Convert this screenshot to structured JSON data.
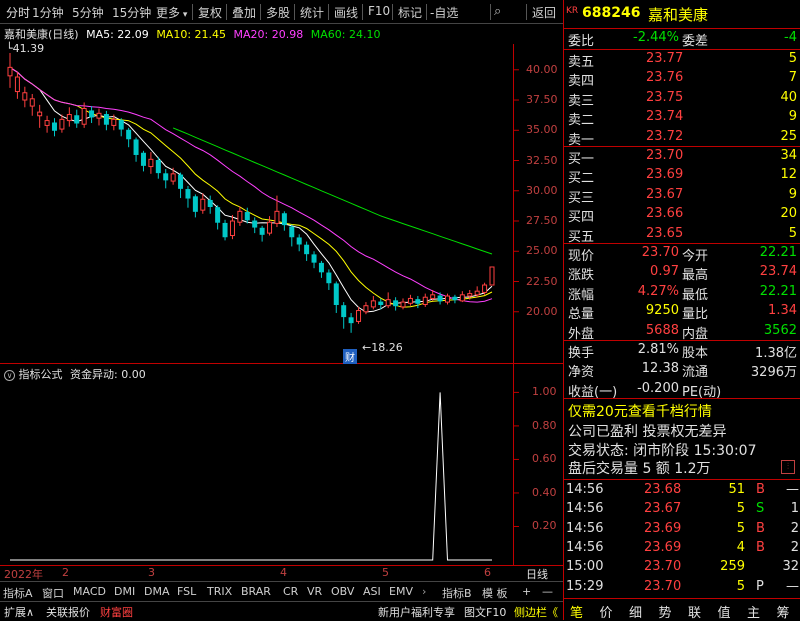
{
  "toolbar": {
    "items": [
      "分时",
      "1分钟",
      "5分钟",
      "15分钟",
      "更多",
      "复权",
      "叠加",
      "多股",
      "统计",
      "画线",
      "F10",
      "标记",
      "-自选",
      "返回"
    ]
  },
  "chart": {
    "stock_title": "嘉和美康(日线)",
    "ma_labels": [
      {
        "text": "MA5: 22.09",
        "color": "#ffffff"
      },
      {
        "text": "MA10: 21.45",
        "color": "#ffff00"
      },
      {
        "text": "MA20: 20.98",
        "color": "#ff40ff"
      },
      {
        "text": "MA60: 24.10",
        "color": "#00e000"
      }
    ],
    "high_label": "41.39",
    "low_label": "18.26",
    "cai_mark": "财",
    "price_ticks": [
      "40.00",
      "37.50",
      "35.00",
      "32.50",
      "30.00",
      "27.50",
      "25.00",
      "22.50",
      "20.00"
    ],
    "indicator_title": "指标公式",
    "indicator_name": "资金异动: 0.00",
    "indicator_ticks": [
      "1.00",
      "0.80",
      "0.60",
      "0.40",
      "0.20"
    ],
    "date_labels": [
      "2022年",
      "2",
      "3",
      "4",
      "5",
      "6"
    ],
    "daily_label": "日线"
  },
  "chart_data": {
    "type": "candlestick",
    "title": "嘉和美康(日线)",
    "candles": [
      [
        39.5,
        40.2,
        38.5,
        41.39
      ],
      [
        38.2,
        39.4,
        37.6,
        39.8
      ],
      [
        37.5,
        38.1,
        36.9,
        38.6
      ],
      [
        37.0,
        37.6,
        36.2,
        38.0
      ],
      [
        36.2,
        36.5,
        35.2,
        37.1
      ],
      [
        35.4,
        35.8,
        34.8,
        36.2
      ],
      [
        35.6,
        35.0,
        34.5,
        36.0
      ],
      [
        35.1,
        35.9,
        34.8,
        36.3
      ],
      [
        35.8,
        36.3,
        35.3,
        36.9
      ],
      [
        36.2,
        35.6,
        35.2,
        36.7
      ],
      [
        35.5,
        36.8,
        35.2,
        37.3
      ],
      [
        36.6,
        36.1,
        35.6,
        37.0
      ],
      [
        36.0,
        36.4,
        35.4,
        36.8
      ],
      [
        36.3,
        35.5,
        35.0,
        36.6
      ],
      [
        35.4,
        35.9,
        35.0,
        36.3
      ],
      [
        35.8,
        35.1,
        34.5,
        36.0
      ],
      [
        35.0,
        34.3,
        33.6,
        35.2
      ],
      [
        34.2,
        33.0,
        32.4,
        34.4
      ],
      [
        33.1,
        32.1,
        31.6,
        33.3
      ],
      [
        32.0,
        32.6,
        31.4,
        33.2
      ],
      [
        32.5,
        31.5,
        31.0,
        32.8
      ],
      [
        31.4,
        30.9,
        30.2,
        31.8
      ],
      [
        30.8,
        31.4,
        30.5,
        31.9
      ],
      [
        31.3,
        30.2,
        29.4,
        31.5
      ],
      [
        30.1,
        29.4,
        28.6,
        30.4
      ],
      [
        29.5,
        28.3,
        27.8,
        29.7
      ],
      [
        28.4,
        29.3,
        28.1,
        29.8
      ],
      [
        29.2,
        28.7,
        28.1,
        29.6
      ],
      [
        28.6,
        27.4,
        26.8,
        28.8
      ],
      [
        27.3,
        26.2,
        25.9,
        27.6
      ],
      [
        26.3,
        27.5,
        26.0,
        28.0
      ],
      [
        27.4,
        28.3,
        27.1,
        28.7
      ],
      [
        28.2,
        27.6,
        27.3,
        28.6
      ],
      [
        27.5,
        27.0,
        26.5,
        27.8
      ],
      [
        26.9,
        26.4,
        25.8,
        27.1
      ],
      [
        26.5,
        27.4,
        26.3,
        27.9
      ],
      [
        27.3,
        28.3,
        27.0,
        29.6
      ],
      [
        28.1,
        27.2,
        26.7,
        28.3
      ],
      [
        27.0,
        26.2,
        25.4,
        27.2
      ],
      [
        26.1,
        25.6,
        25.0,
        26.4
      ],
      [
        25.5,
        24.8,
        24.2,
        25.8
      ],
      [
        24.7,
        24.1,
        23.6,
        25.0
      ],
      [
        24.0,
        23.3,
        22.8,
        24.2
      ],
      [
        23.2,
        22.4,
        21.8,
        23.5
      ],
      [
        22.3,
        20.6,
        19.9,
        22.5
      ],
      [
        20.5,
        19.6,
        18.6,
        20.8
      ],
      [
        19.5,
        19.1,
        18.26,
        19.9
      ],
      [
        19.2,
        20.1,
        19.0,
        20.4
      ],
      [
        20.0,
        20.5,
        19.8,
        20.8
      ],
      [
        20.4,
        20.9,
        20.2,
        21.3
      ],
      [
        20.8,
        20.6,
        20.2,
        21.1
      ],
      [
        20.5,
        21.0,
        20.3,
        21.6
      ],
      [
        20.9,
        20.5,
        20.1,
        21.2
      ],
      [
        20.4,
        20.8,
        20.2,
        21.1
      ],
      [
        20.7,
        21.1,
        20.5,
        21.4
      ],
      [
        21.0,
        20.7,
        20.3,
        21.3
      ],
      [
        20.6,
        21.2,
        20.4,
        21.5
      ],
      [
        21.1,
        21.4,
        20.9,
        21.8
      ],
      [
        21.3,
        20.9,
        20.6,
        21.6
      ],
      [
        20.8,
        21.3,
        20.6,
        21.5
      ],
      [
        21.2,
        21.0,
        20.7,
        21.4
      ],
      [
        20.9,
        21.4,
        20.8,
        21.7
      ],
      [
        21.3,
        21.5,
        21.0,
        21.8
      ],
      [
        21.4,
        21.7,
        21.2,
        22.1
      ],
      [
        21.6,
        22.21,
        21.4,
        22.4
      ],
      [
        22.21,
        23.7,
        22.21,
        23.74
      ]
    ],
    "indicator_values": [
      0,
      0,
      0,
      0,
      0,
      0,
      0,
      0,
      0,
      0,
      0,
      0,
      0,
      0,
      0,
      0,
      0,
      0,
      0,
      0,
      0,
      0,
      0,
      0,
      0,
      0,
      0,
      0,
      0,
      0,
      0,
      0,
      0,
      0,
      0,
      0,
      0,
      0,
      0,
      0,
      0,
      0,
      0,
      0,
      0,
      0,
      0,
      0,
      0,
      0,
      0,
      0,
      0,
      0,
      0,
      0,
      0,
      0,
      1,
      0,
      0,
      0,
      0,
      0,
      0,
      0
    ],
    "price_range": [
      17.5,
      41.8
    ],
    "indicator_range": [
      0,
      1.05
    ]
  },
  "quote": {
    "badge": "KR",
    "code": "688246",
    "name": "嘉和美康",
    "weibi_label": "委比",
    "weibi_value": "-2.44%",
    "weicha_label": "委差",
    "weicha_value": "-4",
    "asks": [
      {
        "label": "卖五",
        "price": "23.77",
        "vol": "5"
      },
      {
        "label": "卖四",
        "price": "23.76",
        "vol": "7"
      },
      {
        "label": "卖三",
        "price": "23.75",
        "vol": "40"
      },
      {
        "label": "卖二",
        "price": "23.74",
        "vol": "9"
      },
      {
        "label": "卖一",
        "price": "23.72",
        "vol": "25"
      }
    ],
    "bids": [
      {
        "label": "买一",
        "price": "23.70",
        "vol": "34"
      },
      {
        "label": "买二",
        "price": "23.69",
        "vol": "12"
      },
      {
        "label": "买三",
        "price": "23.67",
        "vol": "9"
      },
      {
        "label": "买四",
        "price": "23.66",
        "vol": "20"
      },
      {
        "label": "买五",
        "price": "23.65",
        "vol": "5"
      }
    ],
    "stats": [
      {
        "l1": "现价",
        "v1": "23.70",
        "c1": "#ff4040",
        "l2": "今开",
        "v2": "22.21",
        "c2": "#00e000"
      },
      {
        "l1": "涨跌",
        "v1": "0.97",
        "c1": "#ff4040",
        "l2": "最高",
        "v2": "23.74",
        "c2": "#ff4040"
      },
      {
        "l1": "涨幅",
        "v1": "4.27%",
        "c1": "#ff4040",
        "l2": "最低",
        "v2": "22.21",
        "c2": "#00e000"
      },
      {
        "l1": "总量",
        "v1": "9250",
        "c1": "#ffff00",
        "l2": "量比",
        "v2": "1.34",
        "c2": "#ff4040"
      },
      {
        "l1": "外盘",
        "v1": "5688",
        "c1": "#ff4040",
        "l2": "内盘",
        "v2": "3562",
        "c2": "#00e000"
      }
    ],
    "stats2": [
      {
        "l1": "换手",
        "v1": "2.81%",
        "l2": "股本",
        "v2": "1.38亿"
      },
      {
        "l1": "净资",
        "v1": "12.38",
        "l2": "流通",
        "v2": "3296万"
      },
      {
        "l1": "收益(一)",
        "v1": "-0.200",
        "l2": "PE(动)",
        "v2": ""
      }
    ],
    "promo": "仅需20元查看千档行情",
    "promo_num": "20",
    "info1": "公司已盈利 投票权无差异",
    "trade_status": "交易状态: 闭市阶段 15:30:07",
    "after_hours": "盘后交易量 5 额 1.2万",
    "ticks": [
      {
        "time": "14:56",
        "price": "23.68",
        "vol": "51",
        "side": "B",
        "n": "—"
      },
      {
        "time": "14:56",
        "price": "23.67",
        "vol": "5",
        "side": "S",
        "n": "1"
      },
      {
        "time": "14:56",
        "price": "23.69",
        "vol": "5",
        "side": "B",
        "n": "2"
      },
      {
        "time": "14:56",
        "price": "23.69",
        "vol": "4",
        "side": "B",
        "n": "2"
      },
      {
        "time": "15:00",
        "price": "23.70",
        "vol": "259",
        "side": "",
        "n": "32"
      },
      {
        "time": "15:29",
        "price": "23.70",
        "vol": "5",
        "side": "P",
        "n": "—"
      }
    ]
  },
  "bottom_tabs": [
    "指标A",
    "窗口",
    "MACD",
    "DMI",
    "DMA",
    "FSL",
    "TRIX",
    "BRAR",
    "CR",
    "VR",
    "OBV",
    "ASI",
    "EMV"
  ],
  "bottom_right": [
    "指标B",
    "模 板",
    "+",
    "—"
  ],
  "status_left": [
    "扩展∧",
    "关联报价",
    "财富圈"
  ],
  "status_mid": [
    "新用户福利专享",
    "图文F10",
    "侧边栏《"
  ],
  "status_right": [
    "笔",
    "价",
    "细",
    "势",
    "联",
    "值",
    "主",
    "筹"
  ]
}
